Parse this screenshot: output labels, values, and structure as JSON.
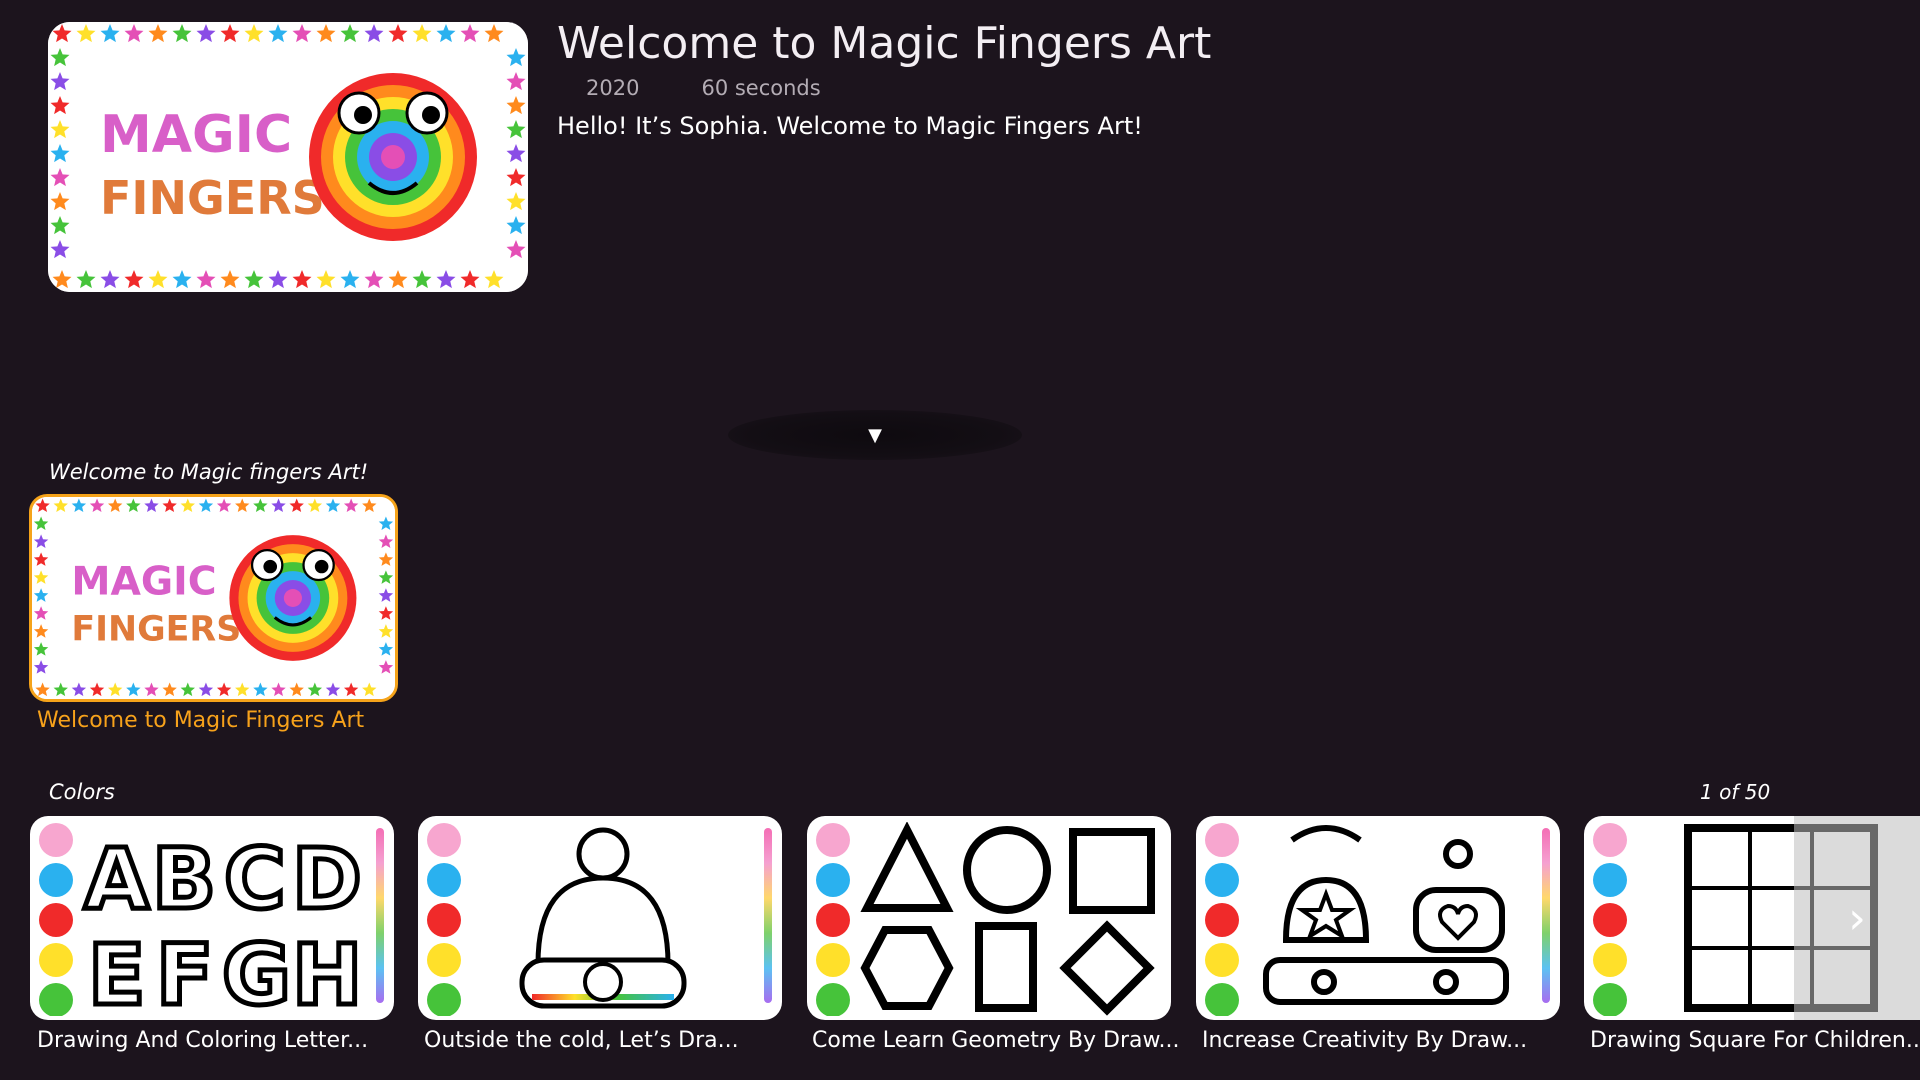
{
  "hero": {
    "title": "Welcome to Magic Fingers Art",
    "year": "2020",
    "duration": "60 seconds",
    "description": "Hello! It’s Sophia. Welcome to Magic Fingers Art!",
    "logo_line1": "MAGIC",
    "logo_line2": "FINGERS"
  },
  "expand_glyph": "▼",
  "rows": [
    {
      "label": "Welcome to Magic fingers Art!",
      "items": [
        {
          "title": "Welcome to Magic Fingers Art",
          "selected": true
        }
      ]
    },
    {
      "label": "Colors",
      "counter": "1 of 50",
      "items": [
        {
          "title": "Drawing And Coloring Letter...",
          "art": "letters"
        },
        {
          "title": "Outside the cold, Let’s Dra...",
          "art": "hat"
        },
        {
          "title": "Come Learn Geometry By Draw...",
          "art": "shapes"
        },
        {
          "title": "Increase Creativity By Draw...",
          "art": "kettle"
        },
        {
          "title": "Drawing Square For Children...",
          "art": "puzzle"
        }
      ]
    }
  ],
  "next_glyph": "›",
  "colors": {
    "background": "#1c141d",
    "selected_accent": "#f7a21b"
  }
}
